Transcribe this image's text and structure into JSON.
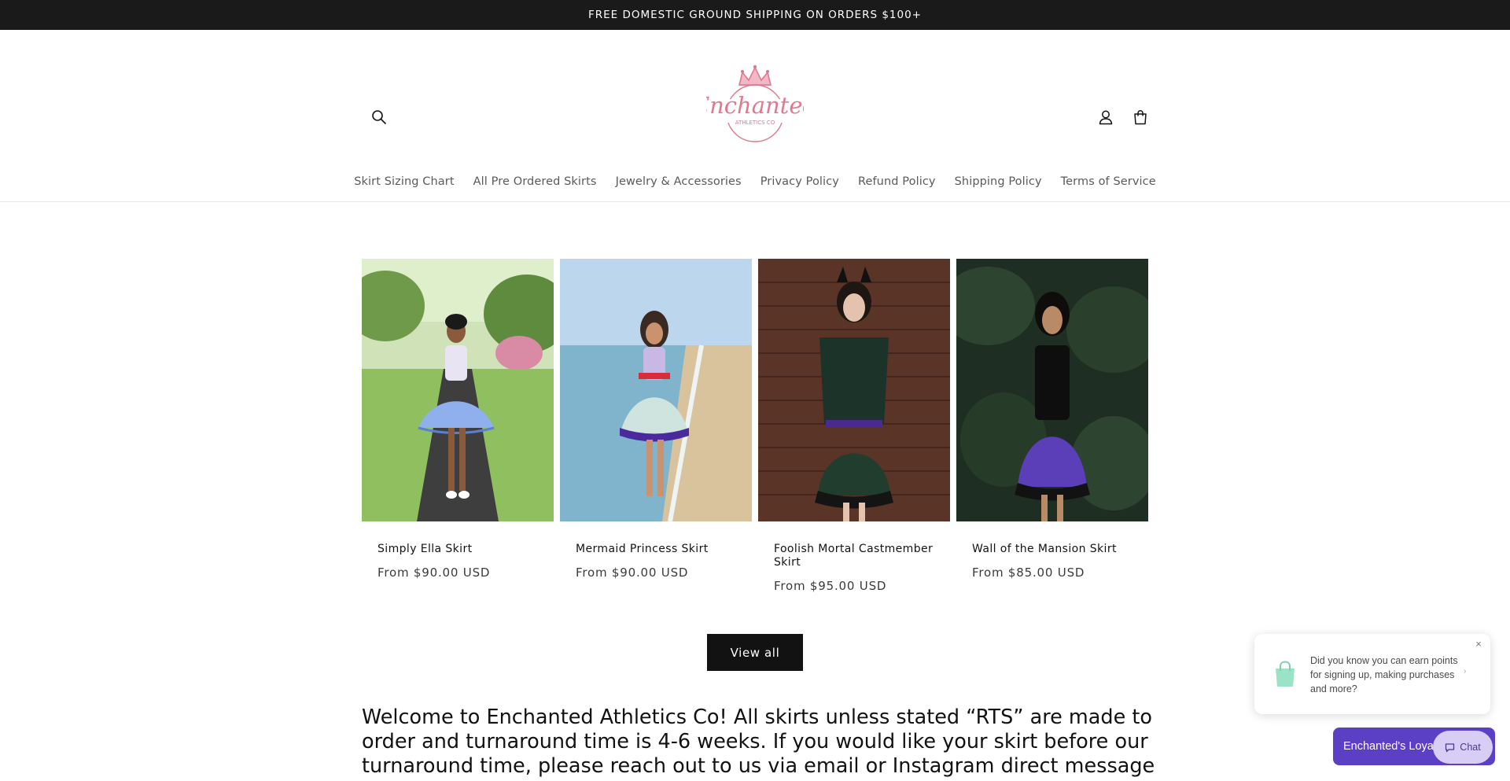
{
  "announcement": {
    "text": "FREE DOMESTIC GROUND SHIPPING ON ORDERS $100+"
  },
  "header": {
    "logo_text_main": "Enchanted",
    "logo_text_sub": "ATHLETICS CO",
    "icons": {
      "search": "search-icon",
      "account": "account-icon",
      "cart": "cart-icon"
    }
  },
  "nav": {
    "items": [
      {
        "label": "Skirt Sizing Chart"
      },
      {
        "label": "All Pre Ordered Skirts"
      },
      {
        "label": "Jewelry & Accessories"
      },
      {
        "label": "Privacy Policy"
      },
      {
        "label": "Refund Policy"
      },
      {
        "label": "Shipping Policy"
      },
      {
        "label": "Terms of Service"
      }
    ]
  },
  "products": [
    {
      "title": "Simply Ella Skirt",
      "price": "From $90.00 USD"
    },
    {
      "title": "Mermaid Princess Skirt",
      "price": "From $90.00 USD"
    },
    {
      "title": "Foolish Mortal Castmember Skirt",
      "price": "From $95.00 USD"
    },
    {
      "title": "Wall of the Mansion Skirt",
      "price": "From $85.00 USD"
    }
  ],
  "view_all_label": "View all",
  "welcome_text": "Welcome to Enchanted Athletics Co! All skirts unless stated “RTS” are made to order and turnaround time is 4-6 weeks. If you would like your skirt before our turnaround time, please reach out to us via email or Instagram direct message prior to placing",
  "loyalty": {
    "popup_text": "Did you know you can earn points for signing up, making purchases and more?",
    "close_symbol": "×",
    "chevron_symbol": "›",
    "button_label": "Enchanted's Loyalty",
    "chat_label": "Chat"
  },
  "colors": {
    "announcement_bg": "#1a1a1a",
    "brand_pink": "#e0788f",
    "loyalty_purple": "#5b3fc4",
    "chat_bg": "#d8cdf4",
    "bag_green": "#9be3c7"
  }
}
